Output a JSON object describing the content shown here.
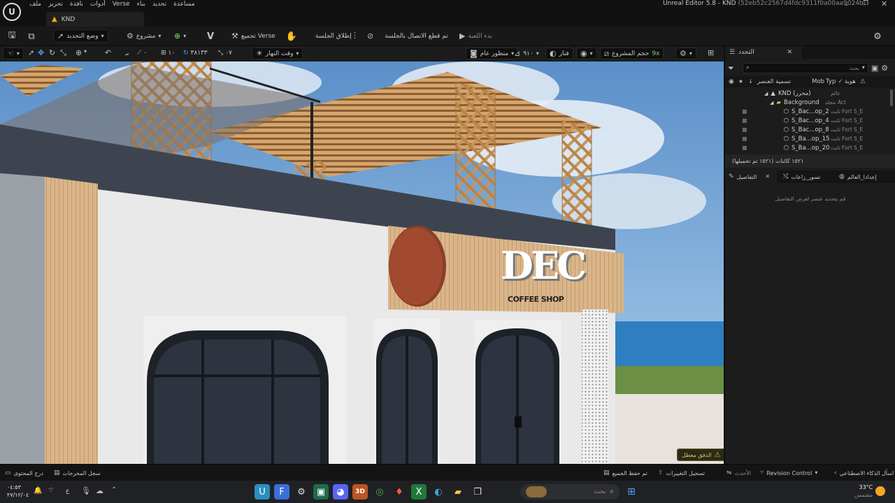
{
  "window": {
    "title": "Unreal Editor 5.8 - KND",
    "hash": "(52eb52c2567d4fdc9311f0a00aa9024b)",
    "menu": [
      "ملف",
      "تحرير",
      "نافذة",
      "أدوات",
      "Verse",
      "بناء",
      "تحديد",
      "مساعدة"
    ]
  },
  "tab": {
    "label": "KND"
  },
  "toolbar": {
    "mode_label": "وضع التحديد",
    "project_label": "مشروع",
    "verse_build_label": "تجميع Verse",
    "launch_session_label": "إطلاق الجلسة",
    "disconnect_label": "تم قطع الاتصال بالجلسة",
    "start_game_label": "بدء اللعبة"
  },
  "viewport_toolbar": {
    "snap_angle": "١٠",
    "snap_value": "٣٨١٣٣",
    "scale_value": "٠٧",
    "time_of_day": "وقت النهار",
    "perspective": "منظور عام",
    "fov": "٩١٠",
    "lit": "فنار",
    "project_size_label": "حجم المشروع",
    "project_size_value": "9x"
  },
  "viewport": {
    "sign_text": "DEC",
    "sign_sub": "COFFEE SHOP",
    "warning_label": "الدفق معطل"
  },
  "outliner": {
    "tab_label": "التحدد",
    "search_placeholder": "بحث",
    "col_name": "تسمية العنصر",
    "col_mob": "Mob",
    "col_type": "Typ",
    "col_id": "هوية",
    "rows": [
      {
        "name": "KND (محرر)",
        "type": "عالم",
        "mob": ""
      },
      {
        "name": "Background",
        "type": "مجلد",
        "mob": "Act"
      },
      {
        "name": "S_Bac...op_2",
        "type": "ثابت",
        "mob": "Fort S_E"
      },
      {
        "name": "S_Bac...op_4",
        "type": "ثابت",
        "mob": "Fort S_E"
      },
      {
        "name": "S_Bac...op_8",
        "type": "ثابت",
        "mob": "Fort S_E"
      },
      {
        "name": "S_Ba...op_15",
        "type": "ثابت",
        "mob": "Fort S_E"
      },
      {
        "name": "S_Ba...op_20",
        "type": "ثابت",
        "mob": "Fort S_E"
      }
    ],
    "count_text": "١٥٢١ كائنات (١٥٢١ تم تحميلها)"
  },
  "details": {
    "tabs": [
      "إعدادا_العالم",
      "تسور_زاعات",
      "التفاصيل"
    ],
    "empty_text": "قم بتحديد عنصر لعرض التفاصيل"
  },
  "statusbar": {
    "content_drawer": "درج المحتوى",
    "output_log": "سجل المخرجات",
    "ask_ai": "اسأل الذكاء الاصطناعي",
    "revision_control": "Revision Control",
    "latest": "الأحدث",
    "record_changes": "تسجيل التغييرات",
    "all_saved": "تم حفظ الجميع"
  },
  "taskbar": {
    "search_placeholder": "بحث",
    "time": "٠٤:٥٣",
    "date": "٢٧/١٢/٠٤",
    "weather_temp": "33°C",
    "weather_desc": "مشمس",
    "lang": "ع"
  },
  "colors": {
    "accent": "#ffb000",
    "sky": "#6fa3d8",
    "wood": "#c8955a",
    "wall": "#e9e9ea"
  }
}
